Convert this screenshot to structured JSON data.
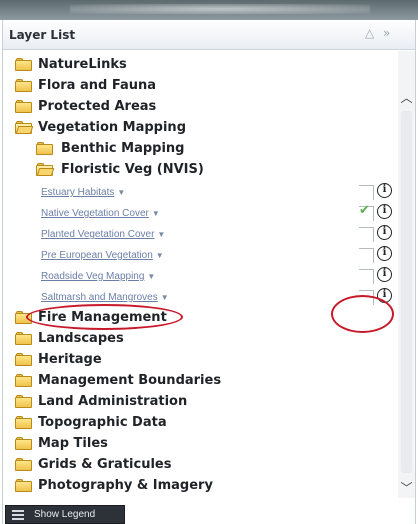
{
  "panel": {
    "title": "Layer List",
    "collapse_icon": "triangle-up-icon",
    "expand_icon": "double-chevron-right-icon"
  },
  "folders_top": [
    {
      "label": "NatureLinks",
      "icon": "folder-icon"
    },
    {
      "label": "Flora and Fauna",
      "icon": "folder-icon"
    },
    {
      "label": "Protected Areas",
      "icon": "folder-icon"
    },
    {
      "label": "Vegetation Mapping",
      "icon": "folder-open-icon"
    }
  ],
  "subfolders": [
    {
      "label": "Benthic Mapping",
      "icon": "folder-icon"
    },
    {
      "label": "Floristic Veg (NVIS)",
      "icon": "folder-open-icon"
    }
  ],
  "layers": [
    {
      "label": "Estuary Habitats",
      "checked": false
    },
    {
      "label": "Native Vegetation Cover",
      "checked": true
    },
    {
      "label": "Planted Vegetation Cover",
      "checked": false
    },
    {
      "label": "Pre European Vegetation",
      "checked": false
    },
    {
      "label": "Roadside Veg Mapping",
      "checked": false
    },
    {
      "label": "Saltmarsh and Mangroves",
      "checked": false
    }
  ],
  "folders_bottom": [
    {
      "label": "Fire Management",
      "icon": "folder-icon"
    },
    {
      "label": "Landscapes",
      "icon": "folder-icon"
    },
    {
      "label": "Heritage",
      "icon": "folder-icon"
    },
    {
      "label": "Management Boundaries",
      "icon": "folder-icon"
    },
    {
      "label": "Land Administration",
      "icon": "folder-icon"
    },
    {
      "label": "Topographic Data",
      "icon": "folder-icon"
    },
    {
      "label": "Map Tiles",
      "icon": "folder-icon"
    },
    {
      "label": "Grids & Graticules",
      "icon": "folder-icon"
    },
    {
      "label": "Photography & Imagery",
      "icon": "folder-icon"
    }
  ],
  "layer_controls": {
    "dropdown_icon": "caret-down-icon",
    "info_icon": "info-icon",
    "info_glyph": "i",
    "check_glyph": "✔"
  },
  "footer": {
    "show_legend_label": "Show Legend",
    "legend_icon": "list-icon"
  },
  "colors": {
    "highlight": "#c8192a",
    "check": "#58b04a",
    "link": "#6b7fa6",
    "folder": "#f2c95a"
  }
}
